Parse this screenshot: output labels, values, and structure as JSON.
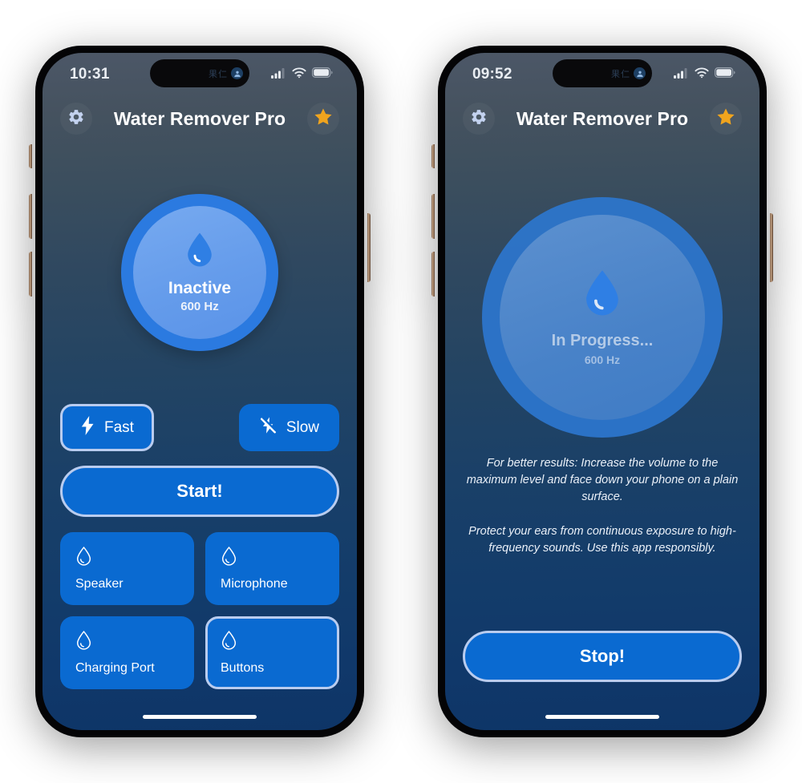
{
  "app": {
    "title": "Water Remover Pro",
    "accent_blue": "#0a6ad1",
    "selected_border": "#b9ccef",
    "star_color": "#f0a41e",
    "gear_color": "#c3d2ef"
  },
  "phones": [
    {
      "id": "phone-idle",
      "status_bar": {
        "clock": "10:31",
        "island_text": "果仁",
        "signal_icon": "cellular-signal-icon",
        "wifi_icon": "wifi-icon",
        "battery_icon": "battery-icon"
      },
      "header": {
        "settings_icon": "gear-icon",
        "title": "Water Remover Pro",
        "favorite_icon": "star-icon"
      },
      "dial": {
        "droplet_icon": "water-droplet-icon",
        "status": "Inactive",
        "frequency": "600 Hz"
      },
      "speed": {
        "fast": {
          "label": "Fast",
          "icon": "bolt-icon",
          "selected": true
        },
        "slow": {
          "label": "Slow",
          "icon": "bolt-slash-icon",
          "selected": false
        }
      },
      "cta": {
        "label": "Start!"
      },
      "tiles": [
        {
          "label": "Speaker",
          "icon": "water-droplet-outline-icon",
          "selected": false
        },
        {
          "label": "Microphone",
          "icon": "water-droplet-outline-icon",
          "selected": false
        },
        {
          "label": "Charging Port",
          "icon": "water-droplet-outline-icon",
          "selected": false
        },
        {
          "label": "Buttons",
          "icon": "water-droplet-outline-icon",
          "selected": true
        }
      ]
    },
    {
      "id": "phone-active",
      "status_bar": {
        "clock": "09:52",
        "island_text": "果仁",
        "signal_icon": "cellular-signal-icon",
        "wifi_icon": "wifi-icon",
        "battery_icon": "battery-icon"
      },
      "header": {
        "settings_icon": "gear-icon",
        "title": "Water Remover Pro",
        "favorite_icon": "star-icon"
      },
      "dial": {
        "droplet_icon": "water-droplet-icon",
        "status": "In Progress...",
        "frequency": "600 Hz"
      },
      "notes": [
        "For better results: Increase the volume to the maximum level and face down your phone on a plain surface.",
        "Protect your ears from continuous exposure to high-frequency sounds. Use this app responsibly."
      ],
      "cta": {
        "label": "Stop!"
      }
    }
  ]
}
